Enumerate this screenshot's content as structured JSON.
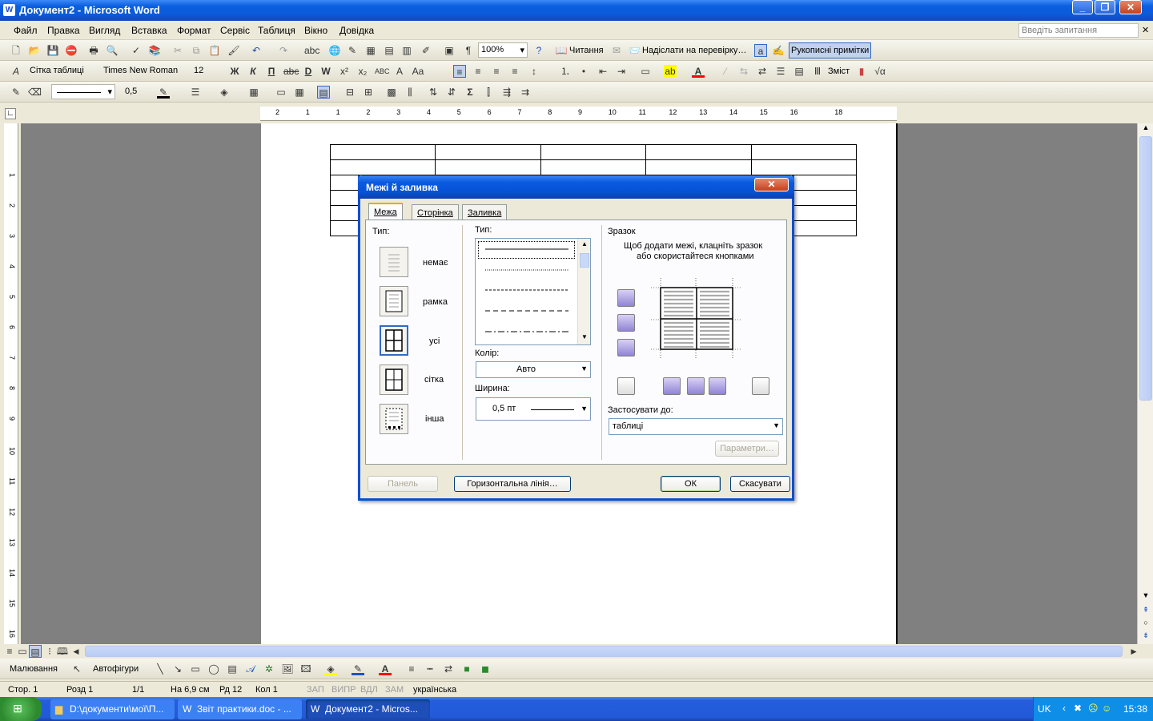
{
  "window": {
    "title": "Документ2 - Microsoft Word",
    "minimize": "_",
    "maximize": "❐",
    "close": "✕"
  },
  "menu": {
    "items": [
      "Файл",
      "Правка",
      "Вигляд",
      "Вставка",
      "Формат",
      "Сервіс",
      "Таблиця",
      "Вікно",
      "Довідка"
    ],
    "ask_placeholder": "Введіть запитання"
  },
  "toolbar_standard": {
    "zoom": "100%",
    "reading": "Читання",
    "send_review": "Надіслати на перевірку…",
    "ink_notes": "Рукописні примітки"
  },
  "toolbar_format": {
    "style": "Сітка таблиці",
    "font": "Times New Roman",
    "size": "12",
    "toc": "Зміст"
  },
  "toolbar_table": {
    "line_width": "0,5"
  },
  "ruler": {
    "marks": [
      "2",
      "1",
      "1",
      "2",
      "3",
      "4",
      "5",
      "6",
      "7",
      "8",
      "9",
      "10",
      "11",
      "12",
      "13",
      "14",
      "15",
      "16",
      "18"
    ]
  },
  "dialog": {
    "title": "Межі й заливка",
    "tabs": [
      "Межа",
      "Сторінка",
      "Заливка"
    ],
    "setting_label": "Тип:",
    "settings": [
      "немає",
      "рамка",
      "усі",
      "сітка",
      "інша"
    ],
    "style_label": "Тип:",
    "color_label": "Колір:",
    "color_value": "Авто",
    "width_label": "Ширина:",
    "width_value": "0,5 пт",
    "preview_label": "Зразок",
    "preview_hint_1": "Щоб додати межі, клацніть зразок",
    "preview_hint_2": "або скористайтеся кнопками",
    "apply_label": "Застосувати до:",
    "apply_value": "таблиці",
    "options_button": "Параметри…",
    "panel_button": "Панель",
    "horizontal_line_button": "Горизонтальна лінія…",
    "ok_button": "ОК",
    "cancel_button": "Скасувати"
  },
  "drawing": {
    "draw_label": "Малювання",
    "autoshapes_label": "Автофігури"
  },
  "status": {
    "page": "Стор. 1",
    "section": "Розд 1",
    "pages": "1/1",
    "at": "На 6,9 см",
    "line": "Рд 12",
    "col": "Кол 1",
    "rec": "ЗАП",
    "trk": "ВИПР",
    "ext": "ВДЛ",
    "ovr": "ЗАМ",
    "language": "українська"
  },
  "taskbar": {
    "buttons": [
      "D:\\документи\\мої\\П...",
      "Звіт практики.doc - ...",
      "Документ2 - Micros..."
    ],
    "lang": "UK",
    "time": "15:38"
  }
}
